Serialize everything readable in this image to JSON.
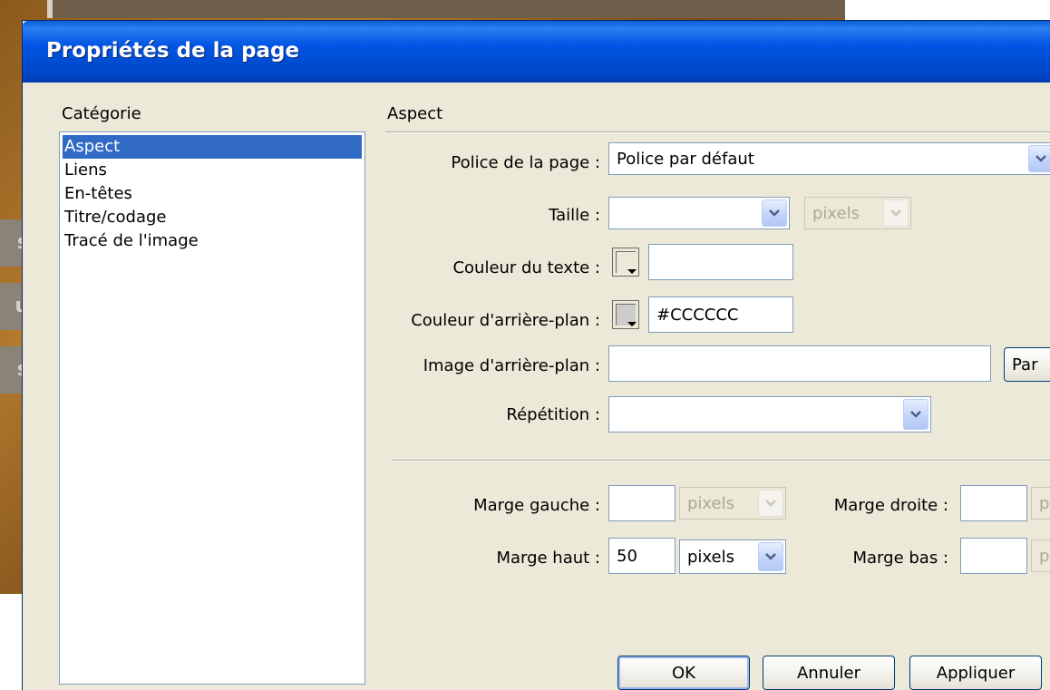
{
  "background_app": {
    "tab_letters": [
      "s",
      "u",
      "s"
    ]
  },
  "dialog": {
    "title": "Propriétés de la page",
    "category_heading": "Catégorie",
    "categories": [
      {
        "label": "Aspect",
        "selected": true
      },
      {
        "label": "Liens",
        "selected": false
      },
      {
        "label": "En-têtes",
        "selected": false
      },
      {
        "label": "Titre/codage",
        "selected": false
      },
      {
        "label": "Tracé de l'image",
        "selected": false
      }
    ],
    "section_title": "Aspect",
    "police": {
      "label": "Police de la page :",
      "value": "Police par défaut"
    },
    "taille": {
      "label": "Taille :",
      "value": "",
      "unit": "pixels"
    },
    "couleur_texte": {
      "label": "Couleur du texte :",
      "value": ""
    },
    "couleur_fond": {
      "label": "Couleur d'arrière-plan :",
      "value": "#CCCCCC"
    },
    "image_fond": {
      "label": "Image d'arrière-plan :",
      "value": "",
      "browse_label": "Par"
    },
    "repetition": {
      "label": "Répétition :",
      "value": ""
    },
    "marge_gauche": {
      "label": "Marge gauche :",
      "value": "",
      "unit": "pixels"
    },
    "marge_droite": {
      "label": "Marge droite :",
      "value": "",
      "unit": "p"
    },
    "marge_haut": {
      "label": "Marge haut :",
      "value": "50",
      "unit": "pixels"
    },
    "marge_bas": {
      "label": "Marge bas :",
      "value": "",
      "unit": "p"
    },
    "buttons": {
      "ok": "OK",
      "cancel": "Annuler",
      "apply": "Appliquer"
    }
  },
  "colors": {
    "titlebar": "#0054e3",
    "dialog_bg": "#ece9d8",
    "selection": "#316ac5",
    "background_color_swatch": "#CCCCCC"
  }
}
